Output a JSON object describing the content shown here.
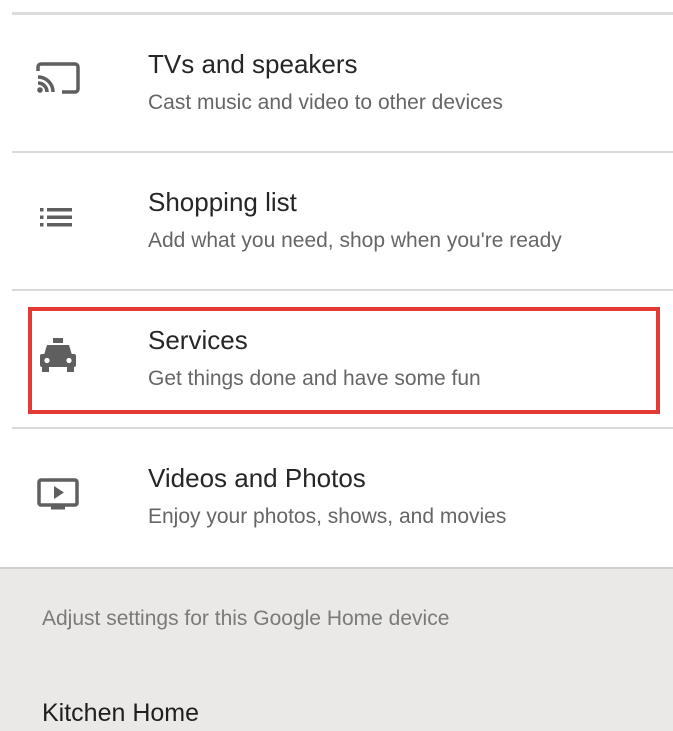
{
  "menu": {
    "items": [
      {
        "title": "TVs and speakers",
        "subtitle": "Cast music and video to other devices",
        "icon": "cast-icon"
      },
      {
        "title": "Shopping list",
        "subtitle": "Add what you need, shop when you're ready",
        "icon": "list-icon"
      },
      {
        "title": "Services",
        "subtitle": "Get things done and have some fun",
        "icon": "taxi-icon",
        "highlighted": true
      },
      {
        "title": "Videos and Photos",
        "subtitle": "Enjoy your photos, shows, and movies",
        "icon": "video-play-icon"
      }
    ]
  },
  "settings": {
    "hint": "Adjust settings for this Google Home device",
    "device_name": "Kitchen Home"
  },
  "colors": {
    "highlight": "#e53935",
    "icon": "#5f5f5f",
    "settings_background": "#ebe9e7"
  }
}
